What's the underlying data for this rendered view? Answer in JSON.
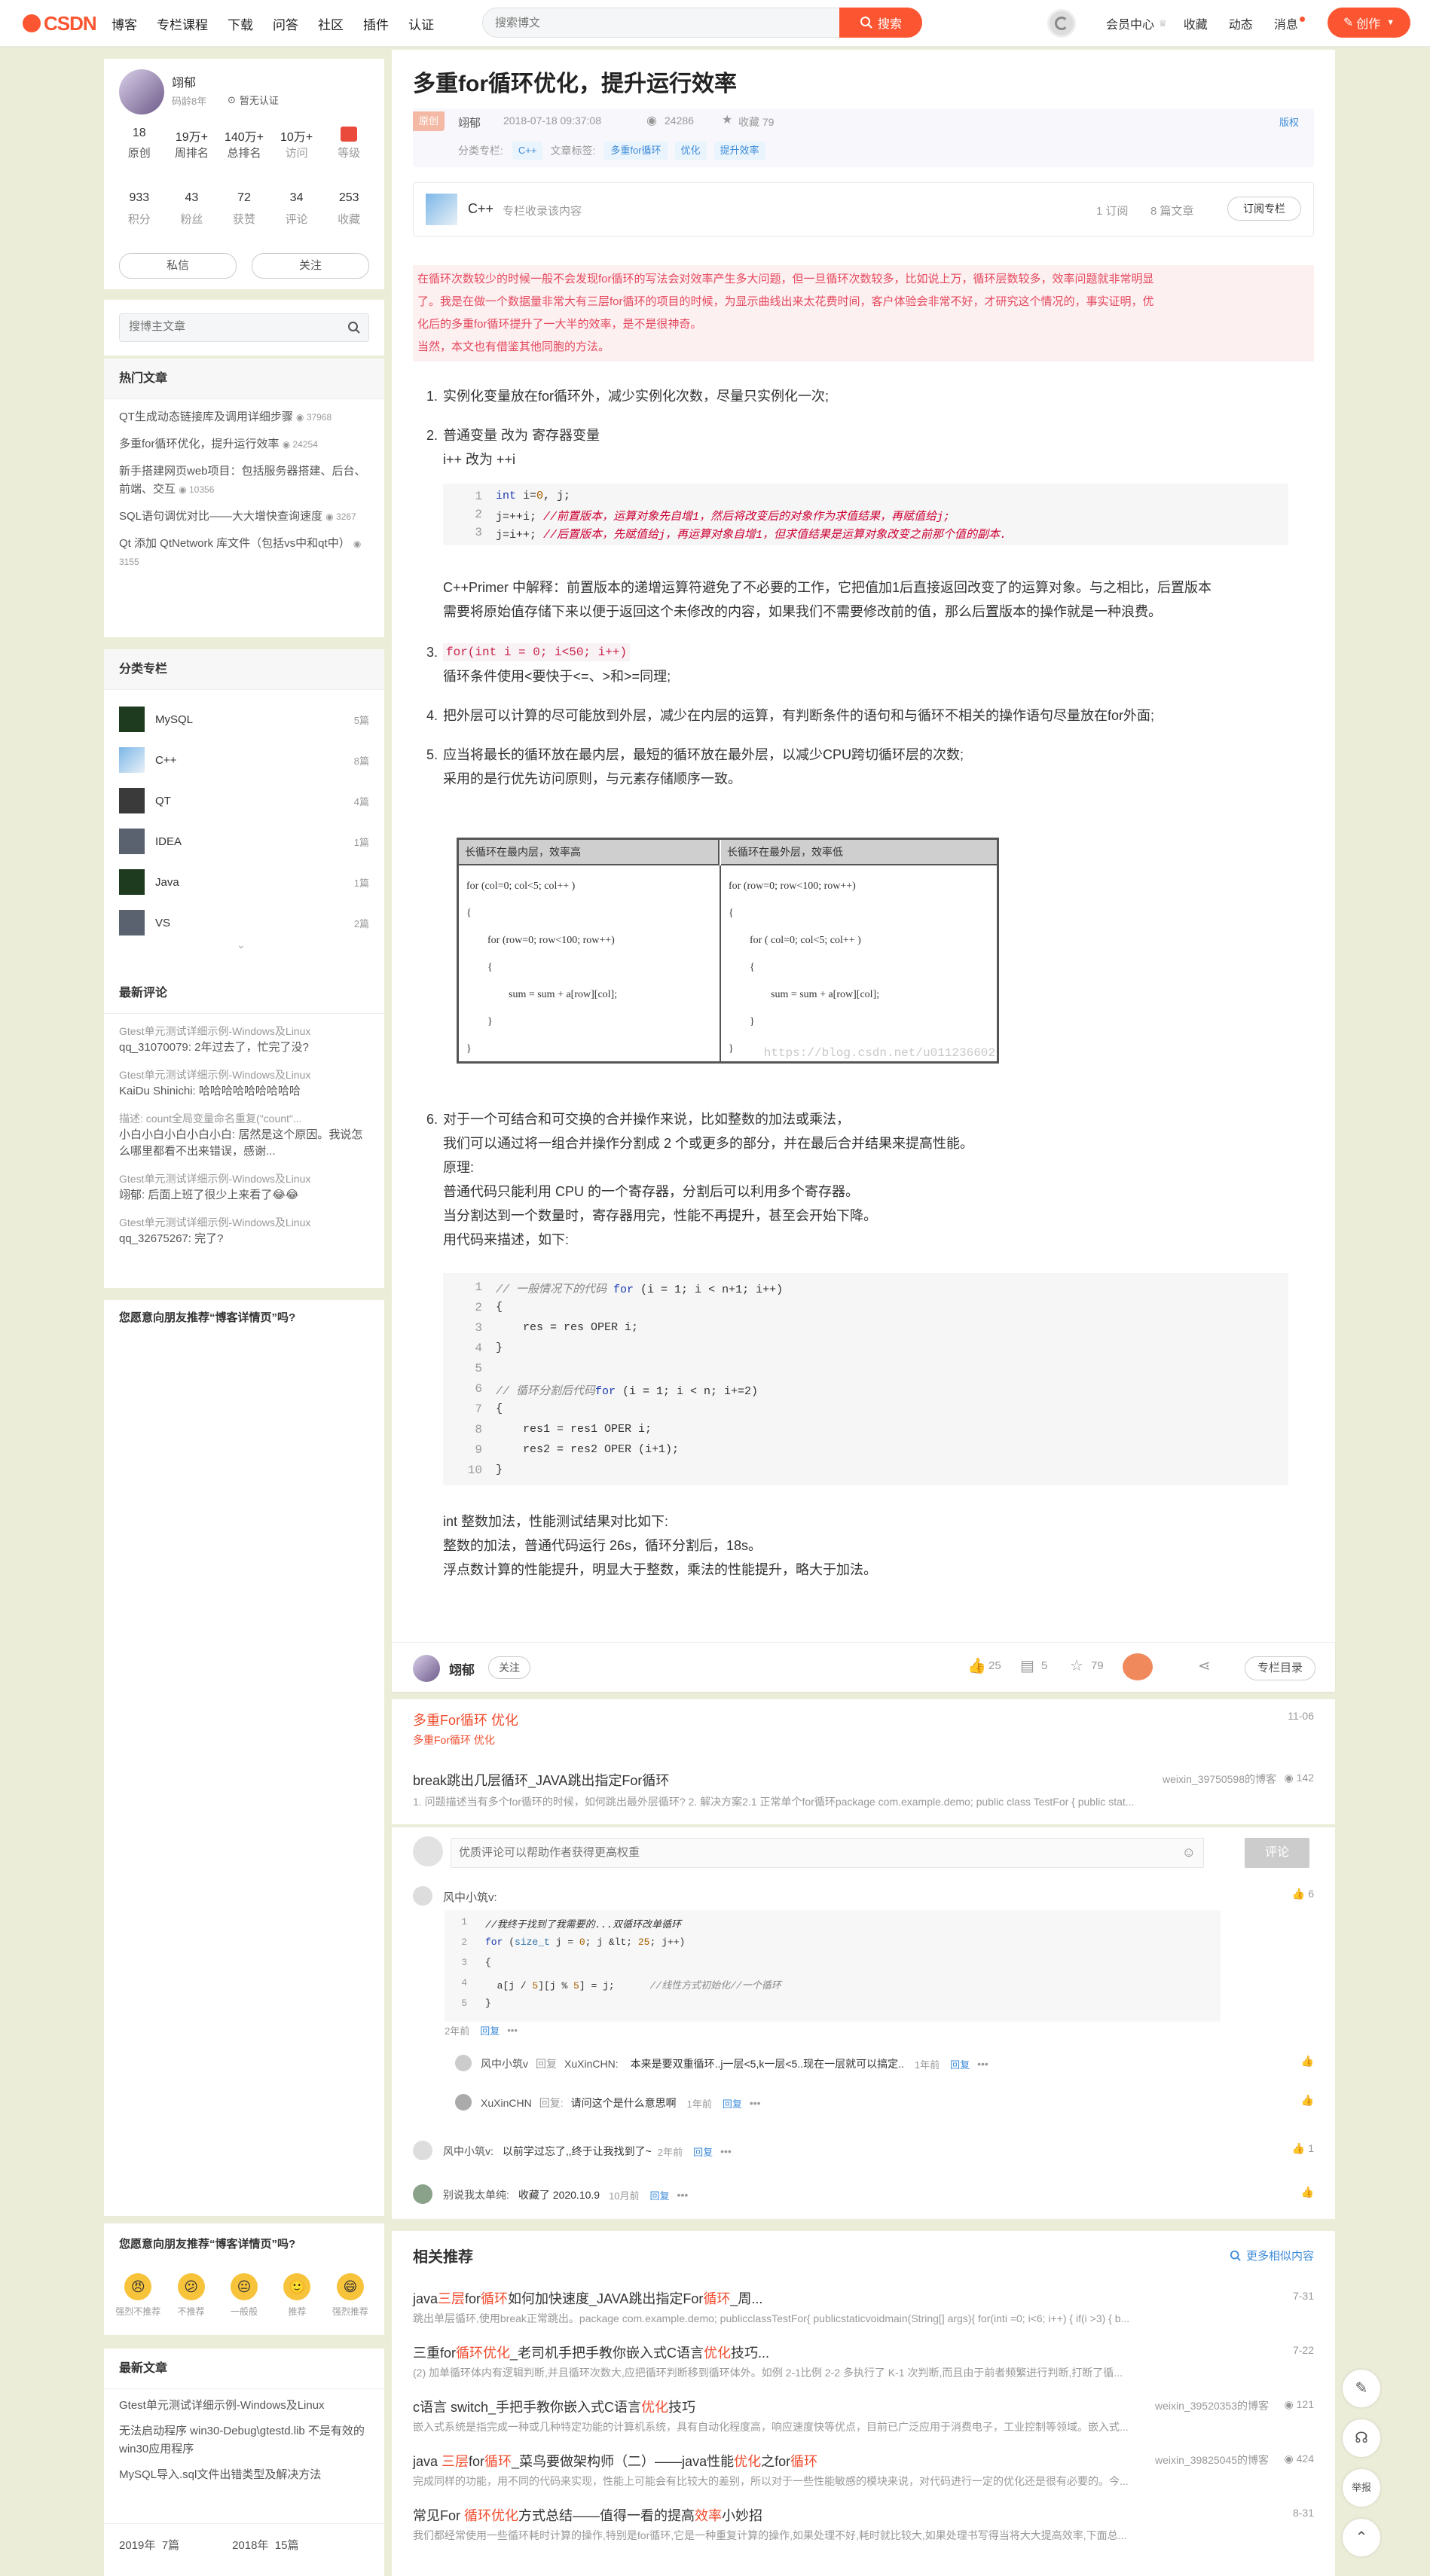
{
  "nav": {
    "logo": "CSDN",
    "links": [
      "博客",
      "专栏课程",
      "下载",
      "问答",
      "社区",
      "插件",
      "认证"
    ],
    "search_placeholder": "搜索博文",
    "search_button": "搜索",
    "right": [
      "会员中心",
      "收藏",
      "动态",
      "消息"
    ],
    "create": "创作"
  },
  "profile": {
    "name": "翊郁",
    "meta": "码龄8年",
    "verify": "暂无认证",
    "stats1": [
      {
        "v": "18",
        "k": "原创"
      },
      {
        "v": "19万+",
        "k": "周排名"
      },
      {
        "v": "140万+",
        "k": "总排名"
      },
      {
        "v": "10万+",
        "k": "访问"
      },
      {
        "v": "",
        "k": "等级"
      }
    ],
    "stats2": [
      {
        "v": "933",
        "k": "积分"
      },
      {
        "v": "43",
        "k": "粉丝"
      },
      {
        "v": "72",
        "k": "获赞"
      },
      {
        "v": "34",
        "k": "评论"
      },
      {
        "v": "253",
        "k": "收藏"
      }
    ],
    "message": "私信",
    "follow": "关注"
  },
  "search_author": {
    "placeholder": "搜博主文章"
  },
  "hot": {
    "title": "热门文章",
    "items": [
      {
        "t": "QT生成动态链接库及调用详细步骤",
        "n": "37968"
      },
      {
        "t": "多重for循环优化，提升运行效率",
        "n": "24254"
      },
      {
        "t": "新手搭建网页web项目：包括服务器搭建、后台、前端、交互",
        "n": "10356"
      },
      {
        "t": "SQL语句调优对比——大大增快查询速度",
        "n": "3267"
      },
      {
        "t": "Qt 添加 QtNetwork 库文件（包括vs中和qt中）",
        "n": "3155"
      }
    ]
  },
  "columns": {
    "title": "分类专栏",
    "items": [
      {
        "name": "MySQL",
        "n": "5篇"
      },
      {
        "name": "C++",
        "n": "8篇"
      },
      {
        "name": "QT",
        "n": "4篇"
      },
      {
        "name": "IDEA",
        "n": "1篇"
      },
      {
        "name": "Java",
        "n": "1篇"
      },
      {
        "name": "VS",
        "n": "2篇"
      }
    ]
  },
  "recent_comments": {
    "title": "最新评论",
    "items": [
      {
        "src": "Gtest单元测试详细示例-Windows及Linux",
        "body": "qq_31070079: 2年过去了，忙完了没?"
      },
      {
        "src": "Gtest单元测试详细示例-Windows及Linux",
        "body": "KaiDu Shinichi: 哈哈哈哈哈哈哈哈哈"
      },
      {
        "src": "描述: count全局变量命名重复(\"count\"...",
        "body": "小白小白小白小白小白: 居然是这个原因。我说怎么哪里都看不出来错误，感谢..."
      },
      {
        "src": "Gtest单元测试详细示例-Windows及Linux",
        "body": "翊郁: 后面上班了很少上来看了😂😂"
      },
      {
        "src": "Gtest单元测试详细示例-Windows及Linux",
        "body": "qq_32675267: 完了?"
      }
    ]
  },
  "recommend_q": "您愿意向朋友推荐“博客详情页”吗?",
  "rating": {
    "title": "您愿意向朋友推荐“博客详情页”吗?",
    "options": [
      "强烈不推荐",
      "不推荐",
      "一般般",
      "推荐",
      "强烈推荐"
    ]
  },
  "latest": {
    "title": "最新文章",
    "items": [
      "Gtest单元测试详细示例-Windows及Linux",
      "无法启动程序 win30-Debug\\gtestd.lib 不是有效的win30应用程序",
      "MySQL导入.sql文件出错类型及解决方法"
    ],
    "archive": [
      {
        "y": "2019年",
        "n": "7篇"
      },
      {
        "y": "2018年",
        "n": "15篇"
      }
    ]
  },
  "article": {
    "title": "多重for循环优化，提升运行效率",
    "badge": "原创",
    "author": "翊郁",
    "date": "2018-07-18 09:37:08",
    "views": "24286",
    "fav": "收藏 79",
    "copyright": "版权",
    "cat_label": "分类专栏:",
    "cat": "C++",
    "tag_label": "文章标签:",
    "tags": [
      "多重for循环",
      "优化",
      "提升效率"
    ],
    "column": {
      "name": "C++",
      "desc": "专栏收录该内容",
      "subs": "1 订阅",
      "count": "8 篇文章",
      "btn": "订阅专栏"
    },
    "intro": [
      "在循环次数较少的时候一般不会发现for循环的写法会对效率产生多大问题，但一旦循环次数较多，比如说上万，循环层数较多，效率问题就非常明显",
      "了。我是在做一个数据量非常大有三层for循环的项目的时候，为显示曲线出来太花费时间，客户体验会非常不好，才研究这个情况的，事实证明，优",
      "化后的多重for循环提升了一大半的效率，是不是很神奇。",
      "当然，本文也有借鉴其他同胞的方法。"
    ],
    "p1": "实例化变量放在for循环外，减少实例化次数，尽量只实例化一次;",
    "p2a": "普通变量 改为 寄存器变量",
    "p2b": "i++ 改为 ++i",
    "code1": [
      [
        "1",
        "int i=0, j;",
        ""
      ],
      [
        "2",
        "j=++i; ",
        "//前置版本，运算对象先自增1，然后将改变后的对象作为求值结果，再赋值给j;"
      ],
      [
        "3",
        "j=i++; ",
        "//后置版本，先赋值给j，再运算对象自增1，但求值结果是运算对象改变之前那个值的副本."
      ]
    ],
    "p2c": "C++Primer 中解释：前置版本的递增运算符避免了不必要的工作，它把值加1后直接返回改变了的运算对象。与之相比，后置版本",
    "p2d": "需要将原始值存储下来以便于返回这个未修改的内容，如果我们不需要修改前的值，那么后置版本的操作就是一种浪费。",
    "p3code": "for(int i = 0; i<50; i++)",
    "p3": "循环条件使用<要快于<=、>和>=同理;",
    "p4": "把外层可以计算的尽可能放到外层，减少在内层的运算，有判断条件的语句和与循环不相关的操作语句尽量放在for外面;",
    "p5a": "应当将最长的循环放在最内层，最短的循环放在最外层，以减少CPU跨切循环层的次数;",
    "p5b": "采用的是行优先访问原则，与元素存储顺序一致。",
    "table": {
      "h1": "长循环在最内层，效率高",
      "h2": "长循环在最外层，效率低",
      "c1": [
        "for (col=0; col<5; col++ )",
        "{",
        "for (row=0; row<100; row++)",
        "{",
        "sum = sum + a[row][col];",
        "}",
        "}"
      ],
      "c2": [
        "for (row=0; row<100; row++)",
        "{",
        "for ( col=0; col<5; col++ )",
        "{",
        "sum = sum + a[row][col];",
        "}",
        "}"
      ],
      "wm": "https://blog.csdn.net/u011236602"
    },
    "p6": [
      "对于一个可结合和可交换的合并操作来说，比如整数的加法或乘法，",
      "我们可以通过将一组合并操作分割成 2 个或更多的部分，并在最后合并结果来提高性能。",
      "原理:",
      "普通代码只能利用 CPU 的一个寄存器，分割后可以利用多个寄存器。",
      "当分割达到一个数量时，寄存器用完，性能不再提升，甚至会开始下降。",
      "用代码来描述，如下:"
    ],
    "code2": [
      [
        "1",
        "// 一般情况下的代码 for (i = 1; i < n+1; i++)"
      ],
      [
        "2",
        "{"
      ],
      [
        "3",
        "    res = res OPER i;"
      ],
      [
        "4",
        "}"
      ],
      [
        "5",
        ""
      ],
      [
        "6",
        "// 循环分割后代码for (i = 1; i < n; i+=2)"
      ],
      [
        "7",
        "{"
      ],
      [
        "8",
        "    res1 = res1 OPER i;"
      ],
      [
        "9",
        "    res2 = res2 OPER (i+1);"
      ],
      [
        "10",
        "}"
      ]
    ],
    "p7": [
      "int 整数加法，性能测试结果对比如下:",
      "整数的加法，普通代码运行 26s，循环分割后，18s。",
      "浮点数计算的性能提升，明显大于整数，乘法的性能提升，略大于加法。"
    ]
  },
  "footerbar": {
    "author": "翊郁",
    "follow": "关注",
    "likes": "25",
    "comments": "5",
    "favs": "79",
    "toc": "专栏目录"
  },
  "related_top": [
    {
      "t": "多重For循环 优化",
      "d": "多重For循环 优化",
      "date": "11-06"
    },
    {
      "t": "break跳出几层循环_JAVA跳出指定For循环",
      "d": "1. 问题描述当有多个for循环的时候，如何跳出最外层循环? 2. 解决方案2.1 正常单个for循环package com.example.demo; public class TestFor { public stat...",
      "author": "weixin_39750598的博客",
      "n": "142"
    }
  ],
  "comment_box": {
    "placeholder": "优质评论可以帮助作者获得更高权重",
    "btn": "评论"
  },
  "comments": {
    "c1": {
      "user": "风中小筑v:",
      "likes": "6",
      "code": [
        [
          "1",
          "//我终于找到了我需要的...双循环改单循环"
        ],
        [
          "2",
          "for (size_t j = 0; j &lt; 25; j++)"
        ],
        [
          "3",
          "{"
        ],
        [
          "4",
          "  a[j / 5][j % 5] = j;      //线性方式初始化//一个循环"
        ],
        [
          "5",
          "}"
        ]
      ],
      "time": "2年前",
      "reply": "回复"
    },
    "r1": {
      "user": "风中小筑v",
      "to": "回复",
      "target": "XuXinCHN:",
      "text": "本来是要双重循环..j一层<5,k一层<5..现在一层就可以搞定..",
      "time": "1年前",
      "reply": "回复"
    },
    "r2": {
      "user": "XuXinCHN",
      "to": "回复:",
      "text": "请问这个是什么意思啊",
      "time": "1年前",
      "reply": "回复"
    },
    "c2": {
      "user": "风中小筑v:",
      "text": "以前学过忘了,,终于让我找到了~",
      "time": "2年前",
      "reply": "回复",
      "likes": "1"
    },
    "c3": {
      "user": "别说我太单纯:",
      "text": "收藏了 2020.10.9",
      "time": "10月前",
      "reply": "回复"
    }
  },
  "related": {
    "title": "相关推荐",
    "more": "更多相似内容",
    "items": [
      {
        "t": "java三层for循环如何加快速度_JAVA跳出指定For循环_周...",
        "d": "跳出单层循环,使用break正常跳出。package com.example.demo; publicclassTestFor{ publicstaticvoidmain(String[] args){ for(inti =0; i<6; i++) { if(i >3) { b...",
        "date": "7-31"
      },
      {
        "t": "三重for循环优化_老司机手把手教你嵌入式C语言优化技巧...",
        "d": "(2) 加单循环体内有逻辑判断,并且循环次数大,应把循环判断移到循环体外。如例 2-1比例 2-2 多执行了 K-1 次判断,而且由于前者频繁进行判断,打断了循...",
        "date": "7-22"
      },
      {
        "t": "c语言 switch_手把手教你嵌入式C语言优化技巧",
        "d": "嵌入式系统是指完成一种或几种特定功能的计算机系统，具有自动化程度高，响应速度快等优点，目前已广泛应用于消费电子，工业控制等领域。嵌入式...",
        "author": "weixin_39520353的博客",
        "n": "121"
      },
      {
        "t": "java 三层for循环_菜鸟要做架构师（二）——java性能优化之for循环",
        "d": "完成同样的功能，用不同的代码来实现，性能上可能会有比较大的差别，所以对于一些性能敏感的模块来说，对代码进行一定的优化还是很有必要的。今...",
        "author": "weixin_39825045的博客",
        "n": "424"
      },
      {
        "t": "常见For 循环优化方式总结——值得一看的提高效率小妙招",
        "d": "我们都经常使用一些循环耗时计算的操作,特别是for循环,它是一种重复计算的操作,如果处理不好,耗时就比较大,如果处理书写得当将大大提高效率,下面总...",
        "date": "8-31"
      }
    ]
  },
  "float": [
    "",
    "",
    "举报",
    ""
  ]
}
